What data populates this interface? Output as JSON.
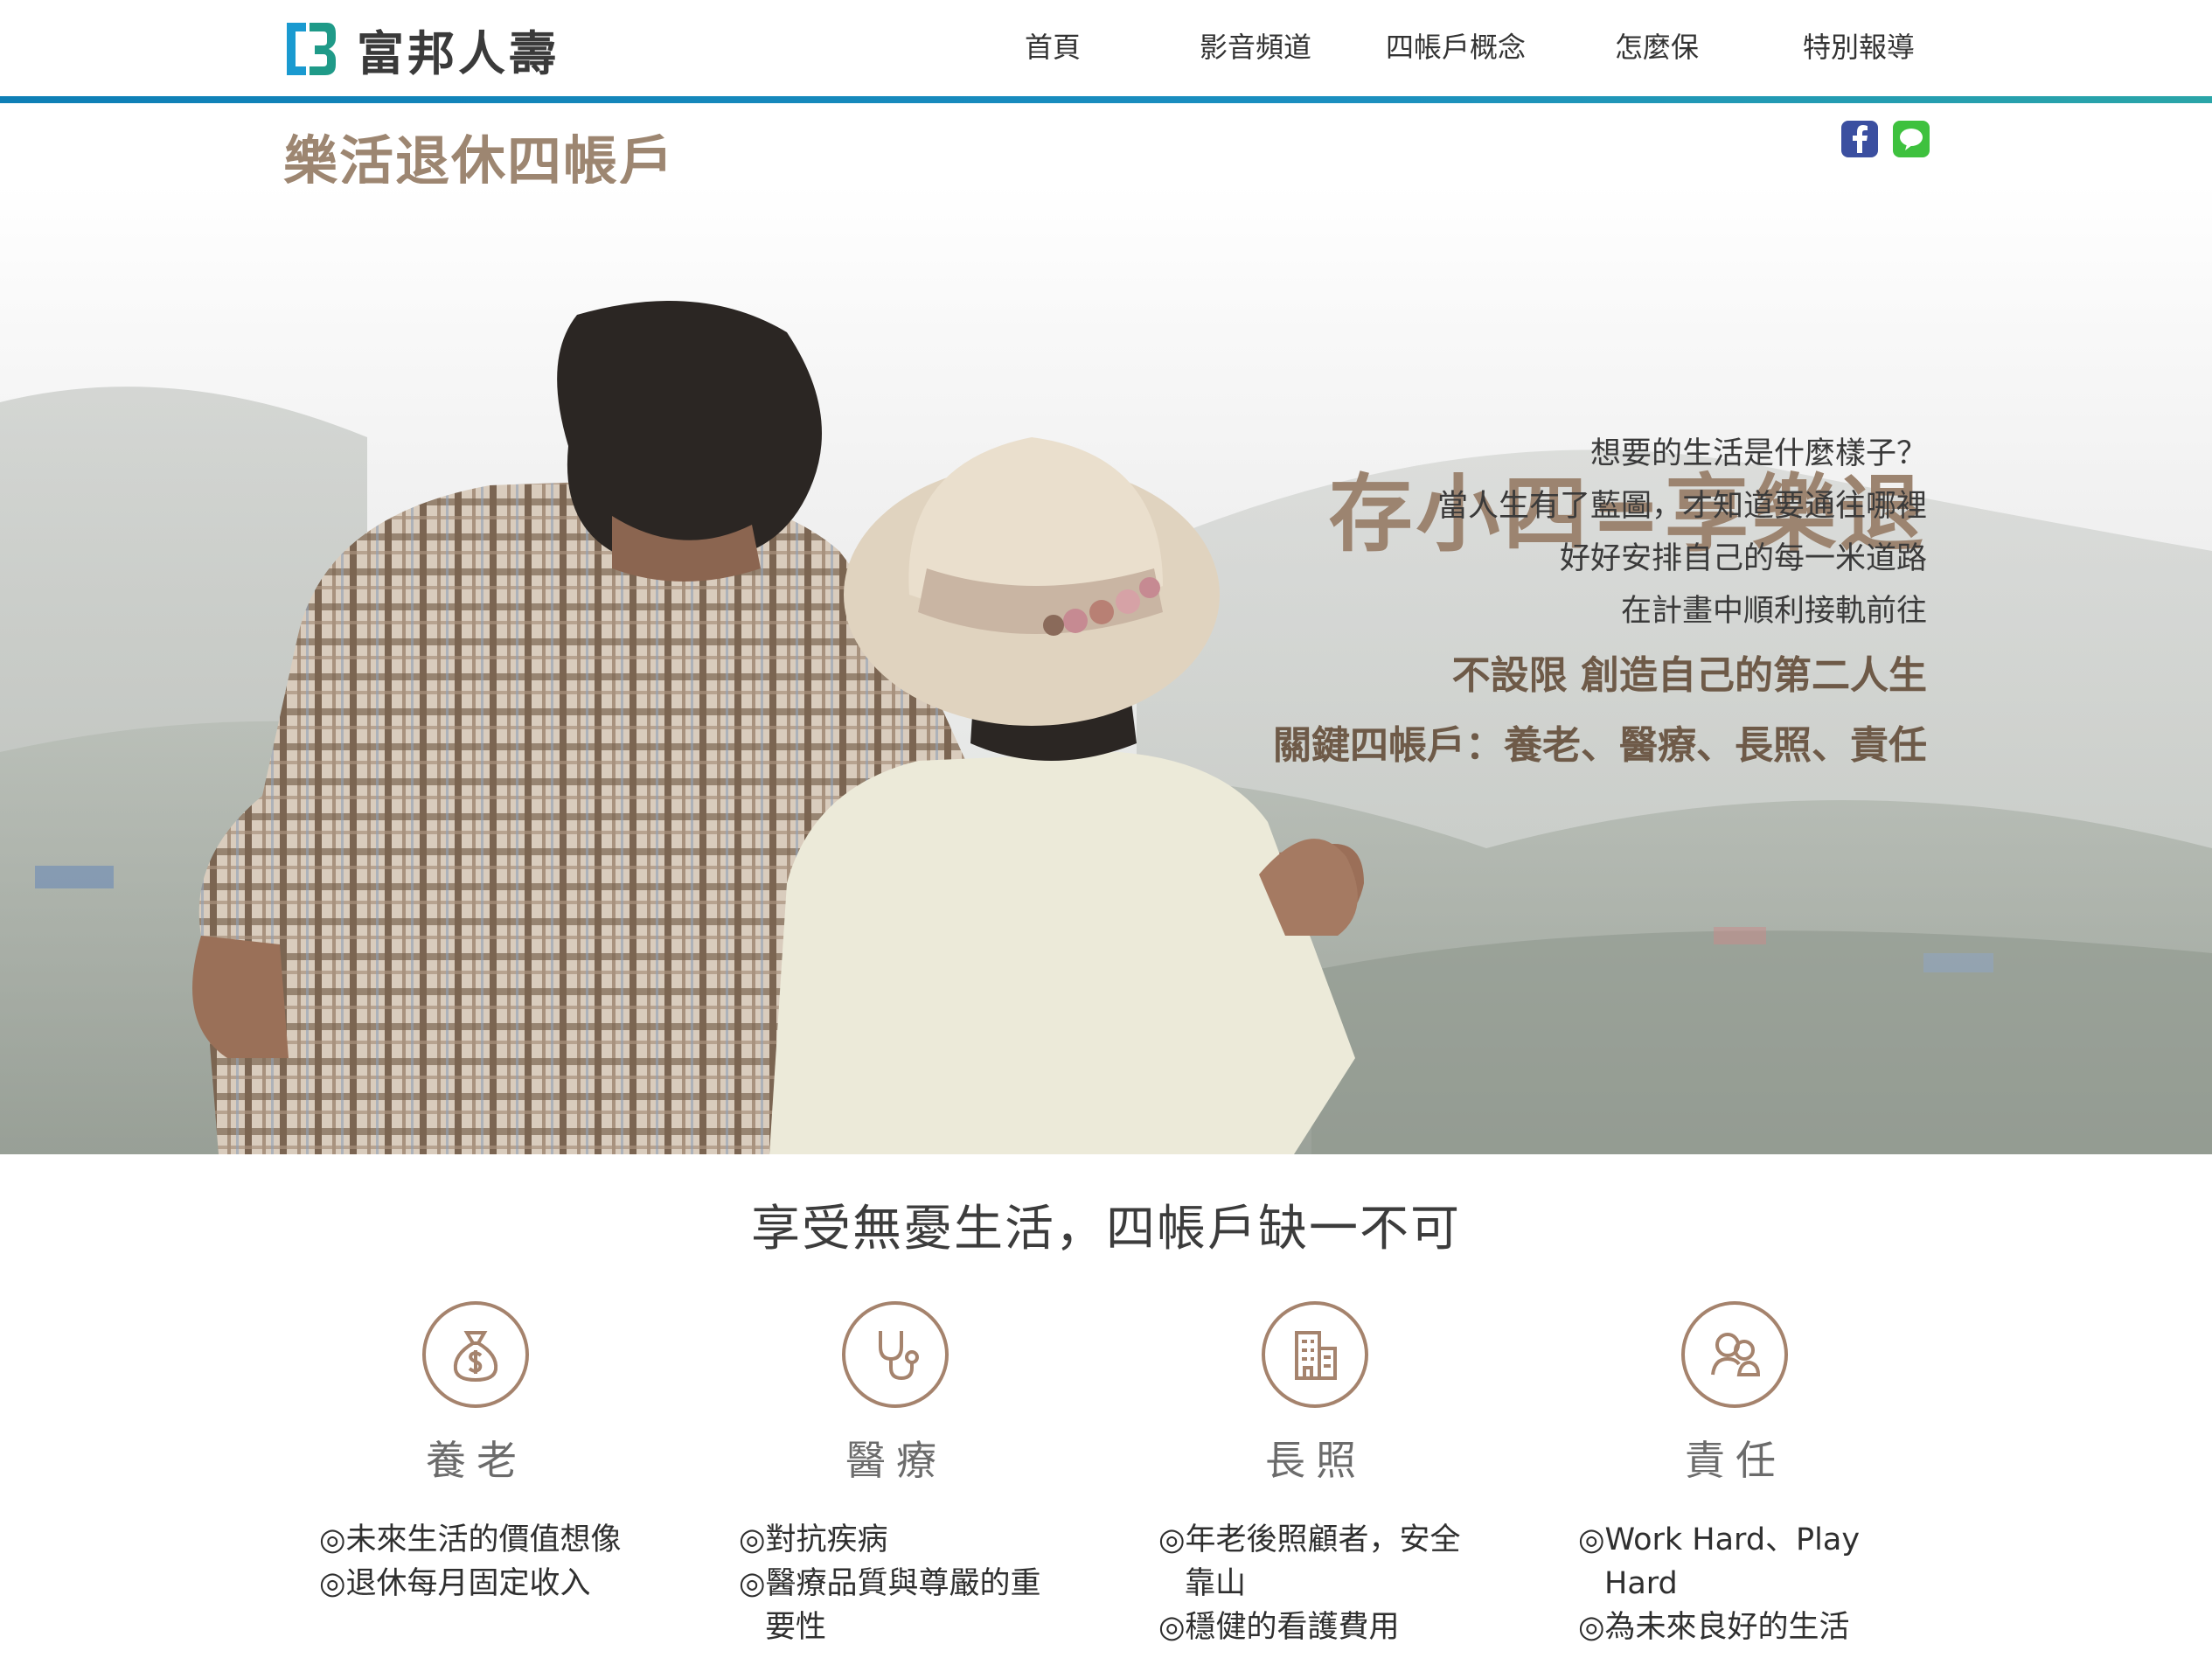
{
  "brand": {
    "name": "富邦人壽",
    "colors": {
      "accent_blue": "#0e7fb6",
      "accent_teal": "#2aa5a8",
      "brown": "#9c8470",
      "icon_brown": "#a5836d"
    }
  },
  "nav": {
    "items": [
      {
        "label": "首頁"
      },
      {
        "label": "影音頻道"
      },
      {
        "label": "四帳戶概念"
      },
      {
        "label": "怎麼保"
      },
      {
        "label": "特別報導"
      }
    ]
  },
  "page": {
    "title": "樂活退休四帳戶"
  },
  "social": {
    "icons": [
      "facebook-icon",
      "line-chat-icon"
    ]
  },
  "hero": {
    "headline": "存小四=享樂退",
    "lines": [
      "想要的生活是什麼樣子？",
      "當人生有了藍圖，才知道要通往哪裡",
      "好好安排自己的每一米道路",
      "在計畫中順利接軌前往"
    ],
    "strong_lines": [
      "不設限 創造自己的第二人生",
      "關鍵四帳戶：養老、醫療、長照、責任"
    ]
  },
  "section": {
    "title": "享受無憂生活，四帳戶缺一不可",
    "accounts": [
      {
        "icon": "money-bag-icon",
        "title": "養老",
        "items": [
          "◎未來生活的價值想像",
          "◎退休每月固定收入"
        ]
      },
      {
        "icon": "stethoscope-icon",
        "title": "醫療",
        "items": [
          "◎對抗疾病",
          "◎醫療品質與尊嚴的重要性"
        ]
      },
      {
        "icon": "building-icon",
        "title": "長照",
        "items": [
          "◎年老後照顧者，安全靠山",
          "◎穩健的看護費用"
        ]
      },
      {
        "icon": "family-icon",
        "title": "責任",
        "items": [
          "◎Work Hard、Play Hard",
          "◎為未來良好的生活"
        ]
      }
    ]
  }
}
